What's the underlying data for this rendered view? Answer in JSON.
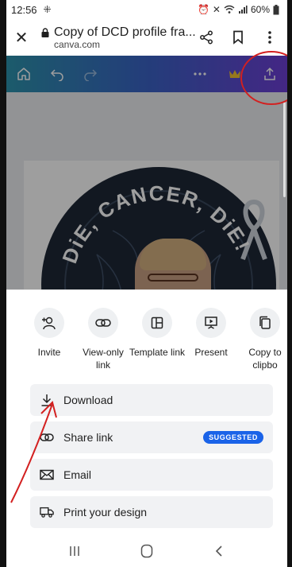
{
  "status_bar": {
    "time": "12:56",
    "battery": "60%"
  },
  "browser": {
    "page_title": "Copy of DCD profile fra...",
    "domain": "canva.com"
  },
  "artwork": {
    "arc_text": "DiE, CANCER, DiE!"
  },
  "share_options": [
    {
      "label": "Invite",
      "icon": "add-person-icon"
    },
    {
      "label": "View-only link",
      "icon": "link-icon"
    },
    {
      "label": "Template link",
      "icon": "template-icon"
    },
    {
      "label": "Present",
      "icon": "present-icon"
    },
    {
      "label": "Copy to clipbo",
      "icon": "copy-icon"
    }
  ],
  "actions": [
    {
      "label": "Download",
      "icon": "download-icon"
    },
    {
      "label": "Share link",
      "icon": "link-icon",
      "badge": "SUGGESTED"
    },
    {
      "label": "Email",
      "icon": "email-icon"
    },
    {
      "label": "Print your design",
      "icon": "truck-icon"
    }
  ],
  "colors": {
    "toolbar_gradient": [
      "#2d93ad",
      "#3a63c6",
      "#6d3fd6"
    ],
    "badge": "#1a63e8",
    "annotation": "#d32020"
  }
}
